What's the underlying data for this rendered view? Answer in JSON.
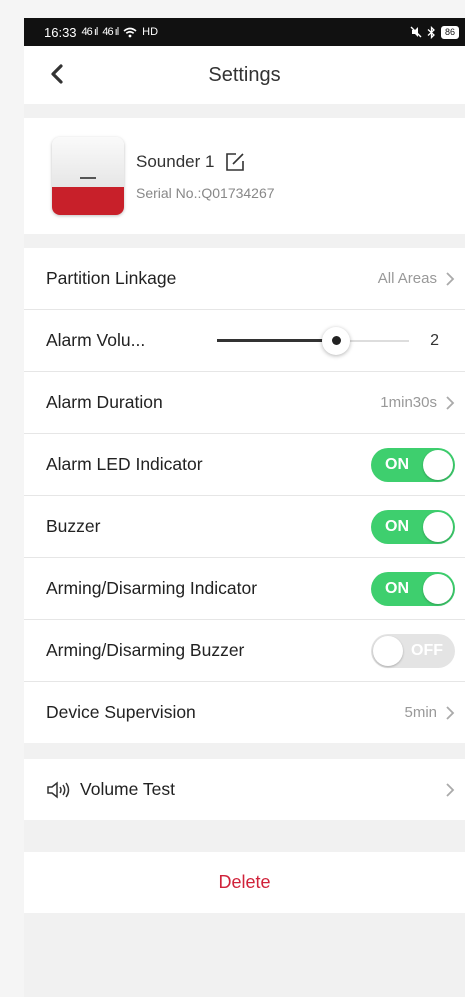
{
  "status_bar": {
    "time": "16:33",
    "signal1": "46 ıl",
    "signal2": "46 ıl",
    "wifi": "HD",
    "battery": "86"
  },
  "header": {
    "title": "Settings",
    "back_icon": "chevron-left-icon"
  },
  "device": {
    "name": "Sounder 1",
    "serial": "Serial No.:Q01734267",
    "edit_icon": "edit-icon"
  },
  "settings": {
    "partition_linkage": {
      "label": "Partition Linkage",
      "value": "All Areas"
    },
    "alarm_volume": {
      "label": "Alarm Volu...",
      "value": "2",
      "level": 0.62
    },
    "alarm_duration": {
      "label": "Alarm Duration",
      "value": "1min30s"
    },
    "alarm_led": {
      "label": "Alarm LED Indicator",
      "state": "ON"
    },
    "buzzer": {
      "label": "Buzzer",
      "state": "ON"
    },
    "arming_indicator": {
      "label": "Arming/Disarming Indicator",
      "state": "ON"
    },
    "arming_buzzer": {
      "label": "Arming/Disarming Buzzer",
      "state": "OFF"
    },
    "device_supervision": {
      "label": "Device Supervision",
      "value": "5min"
    }
  },
  "volume_test": {
    "label": "Volume Test",
    "icon": "speaker-icon"
  },
  "delete": {
    "label": "Delete"
  },
  "colors": {
    "toggle_on": "#3ecf6e",
    "toggle_off": "#e4e4e4",
    "delete": "#d0223a",
    "device_red": "#c8202a"
  }
}
